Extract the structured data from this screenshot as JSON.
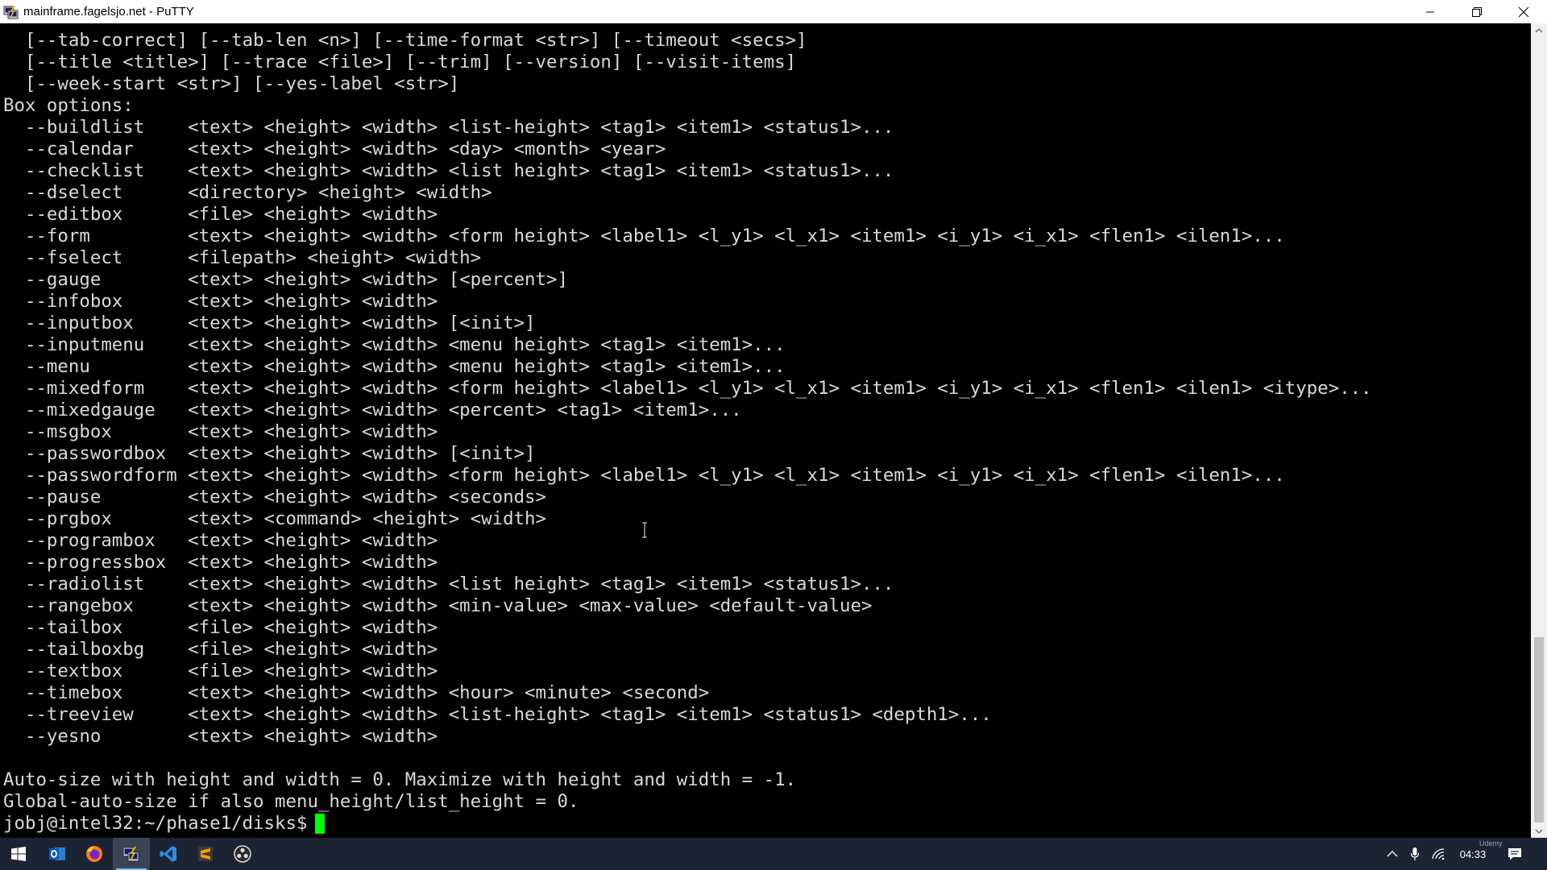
{
  "window": {
    "title": "mainframe.fagelsjo.net - PuTTY",
    "icons": {
      "app": "putty-icon",
      "minimize": "minimize-icon",
      "maximize": "restore-icon",
      "close": "close-icon"
    }
  },
  "terminal": {
    "lines": [
      "  [--tab-correct] [--tab-len <n>] [--time-format <str>] [--timeout <secs>]",
      "  [--title <title>] [--trace <file>] [--trim] [--version] [--visit-items]",
      "  [--week-start <str>] [--yes-label <str>]",
      "Box options:",
      "  --buildlist    <text> <height> <width> <list-height> <tag1> <item1> <status1>...",
      "  --calendar     <text> <height> <width> <day> <month> <year>",
      "  --checklist    <text> <height> <width> <list height> <tag1> <item1> <status1>...",
      "  --dselect      <directory> <height> <width>",
      "  --editbox      <file> <height> <width>",
      "  --form         <text> <height> <width> <form height> <label1> <l_y1> <l_x1> <item1> <i_y1> <i_x1> <flen1> <ilen1>...",
      "  --fselect      <filepath> <height> <width>",
      "  --gauge        <text> <height> <width> [<percent>]",
      "  --infobox      <text> <height> <width>",
      "  --inputbox     <text> <height> <width> [<init>]",
      "  --inputmenu    <text> <height> <width> <menu height> <tag1> <item1>...",
      "  --menu         <text> <height> <width> <menu height> <tag1> <item1>...",
      "  --mixedform    <text> <height> <width> <form height> <label1> <l_y1> <l_x1> <item1> <i_y1> <i_x1> <flen1> <ilen1> <itype>...",
      "  --mixedgauge   <text> <height> <width> <percent> <tag1> <item1>...",
      "  --msgbox       <text> <height> <width>",
      "  --passwordbox  <text> <height> <width> [<init>]",
      "  --passwordform <text> <height> <width> <form height> <label1> <l_y1> <l_x1> <item1> <i_y1> <i_x1> <flen1> <ilen1>...",
      "  --pause        <text> <height> <width> <seconds>",
      "  --prgbox       <text> <command> <height> <width>",
      "  --programbox   <text> <height> <width>",
      "  --progressbox  <text> <height> <width>",
      "  --radiolist    <text> <height> <width> <list height> <tag1> <item1> <status1>...",
      "  --rangebox     <text> <height> <width> <min-value> <max-value> <default-value>",
      "  --tailbox      <file> <height> <width>",
      "  --tailboxbg    <file> <height> <width>",
      "  --textbox      <file> <height> <width>",
      "  --timebox      <text> <height> <width> <hour> <minute> <second>",
      "  --treeview     <text> <height> <width> <list-height> <tag1> <item1> <status1> <depth1>...",
      "  --yesno        <text> <height> <width>",
      "",
      "Auto-size with height and width = 0. Maximize with height and width = -1.",
      "Global-auto-size if also menu_height/list_height = 0."
    ],
    "prompt": "jobj@intel32:~/phase1/disks$",
    "colors": {
      "background": "#000000",
      "foreground": "#d9d9d9",
      "cursor": "#00ff00"
    }
  },
  "taskbar": {
    "items": [
      {
        "icon": "windows-start-icon",
        "active": false
      },
      {
        "icon": "outlook-icon",
        "active": false
      },
      {
        "icon": "firefox-icon",
        "active": false
      },
      {
        "icon": "putty-icon",
        "active": true
      },
      {
        "icon": "vscode-icon",
        "active": false
      },
      {
        "icon": "sublime-text-icon",
        "active": false
      },
      {
        "icon": "obs-icon",
        "active": false
      }
    ],
    "tray": {
      "icons": [
        "chevron-up-icon",
        "microphone-icon",
        "wifi-icon",
        "notification-icon"
      ],
      "time": "04:33",
      "watermark": "Udemy"
    },
    "colors": {
      "background": "#1c2433",
      "accent": "#76b9ed"
    }
  }
}
